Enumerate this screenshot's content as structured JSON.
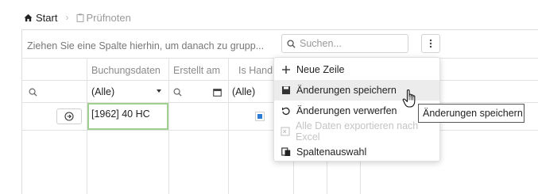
{
  "breadcrumb": {
    "home": "Start",
    "current": "Prüfnoten"
  },
  "toolbar": {
    "group_panel": "Ziehen Sie eine Spalte hierhin, um danach zu grupp...",
    "search_placeholder": "Suchen..."
  },
  "columns": [
    {
      "label": "Buchungsdaten"
    },
    {
      "label": "Erstellt am"
    },
    {
      "label": "Is Handl"
    }
  ],
  "filters": {
    "buchungsdaten": "(Alle)",
    "is_handled": "(Alle)"
  },
  "row": {
    "buchungsdaten": "[1962] 40 HC"
  },
  "menu": {
    "items": [
      {
        "label": "Neue Zeile"
      },
      {
        "label": "Änderungen speichern"
      },
      {
        "label": "Änderungen verwerfen"
      },
      {
        "label": "Alle Daten exportieren nach Excel"
      },
      {
        "label": "Spaltenauswahl"
      }
    ]
  },
  "tooltip": "Änderungen speichern",
  "colors": {
    "accent": "#2c7bd4",
    "selected_border": "#9fd08f",
    "hover": "#ececec"
  }
}
